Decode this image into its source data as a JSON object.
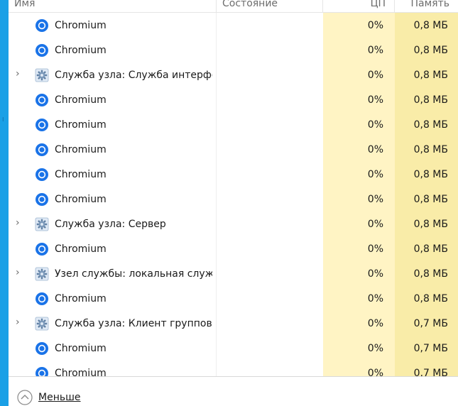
{
  "header": {
    "name": "Имя",
    "status": "Состояние",
    "cpu": "ЦП",
    "memory": "Память"
  },
  "colors": {
    "accent_strip": "#1aa0e6",
    "cpu_column_bg": "#fff4c4",
    "memory_column_bg": "#f9eca8",
    "chromium_blue": "#1a73e8"
  },
  "rows": [
    {
      "icon": "chromium-icon",
      "expandable": false,
      "name": "Chromium",
      "status": "",
      "cpu": "0%",
      "memory": "0,8 МБ"
    },
    {
      "icon": "chromium-icon",
      "expandable": false,
      "name": "Chromium",
      "status": "",
      "cpu": "0%",
      "memory": "0,8 МБ"
    },
    {
      "icon": "gear-icon",
      "expandable": true,
      "name": "Служба узла: Служба интерфе...",
      "status": "",
      "cpu": "0%",
      "memory": "0,8 МБ"
    },
    {
      "icon": "chromium-icon",
      "expandable": false,
      "name": "Chromium",
      "status": "",
      "cpu": "0%",
      "memory": "0,8 МБ"
    },
    {
      "icon": "chromium-icon",
      "expandable": false,
      "name": "Chromium",
      "status": "",
      "cpu": "0%",
      "memory": "0,8 МБ"
    },
    {
      "icon": "chromium-icon",
      "expandable": false,
      "name": "Chromium",
      "status": "",
      "cpu": "0%",
      "memory": "0,8 МБ"
    },
    {
      "icon": "chromium-icon",
      "expandable": false,
      "name": "Chromium",
      "status": "",
      "cpu": "0%",
      "memory": "0,8 МБ"
    },
    {
      "icon": "chromium-icon",
      "expandable": false,
      "name": "Chromium",
      "status": "",
      "cpu": "0%",
      "memory": "0,8 МБ"
    },
    {
      "icon": "gear-icon",
      "expandable": true,
      "name": "Служба узла: Сервер",
      "status": "",
      "cpu": "0%",
      "memory": "0,8 МБ"
    },
    {
      "icon": "chromium-icon",
      "expandable": false,
      "name": "Chromium",
      "status": "",
      "cpu": "0%",
      "memory": "0,8 МБ"
    },
    {
      "icon": "gear-icon",
      "expandable": true,
      "name": "Узел службы: локальная служ...",
      "status": "",
      "cpu": "0%",
      "memory": "0,8 МБ"
    },
    {
      "icon": "chromium-icon",
      "expandable": false,
      "name": "Chromium",
      "status": "",
      "cpu": "0%",
      "memory": "0,8 МБ"
    },
    {
      "icon": "gear-icon",
      "expandable": true,
      "name": "Служба узла: Клиент группово...",
      "status": "",
      "cpu": "0%",
      "memory": "0,7 МБ"
    },
    {
      "icon": "chromium-icon",
      "expandable": false,
      "name": "Chromium",
      "status": "",
      "cpu": "0%",
      "memory": "0,7 МБ"
    },
    {
      "icon": "chromium-icon",
      "expandable": false,
      "name": "Chromium",
      "status": "",
      "cpu": "0%",
      "memory": "0,7 МБ"
    }
  ],
  "footer": {
    "fewer_details_label": "Меньше",
    "fewer_details_icon": "chevron-up-circle-icon"
  }
}
